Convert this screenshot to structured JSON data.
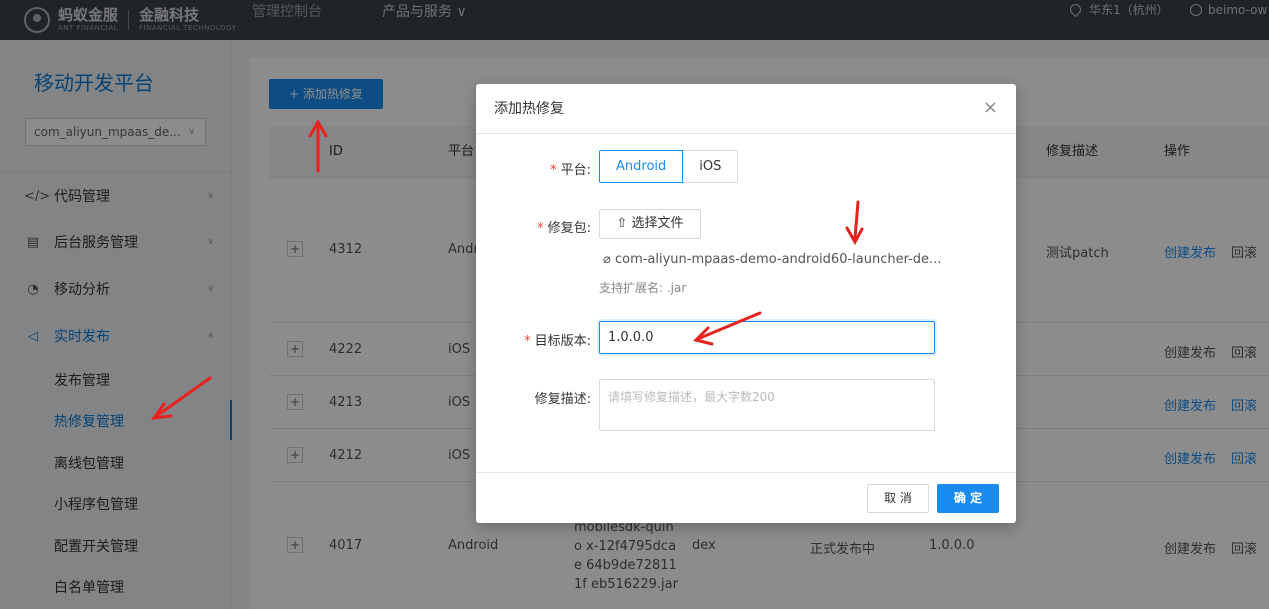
{
  "topbar": {
    "logo_cn_1": "蚂蚁金服",
    "logo_en_1": "ANT FINANCIAL",
    "logo_cn_2": "金融科技",
    "logo_en_2": "FINANCIAL TECHNOLOGY",
    "console": "管理控制台",
    "products": "产品与服务 ∨",
    "region": "华东1（杭州）",
    "user": "beimo-ow"
  },
  "sidebar": {
    "title": "移动开发平台",
    "app_select": "com_aliyun_mpaas_de...",
    "items": [
      {
        "icon": "</>",
        "label": "代码管理"
      },
      {
        "icon": "▤",
        "label": "后台服务管理"
      },
      {
        "icon": "◔",
        "label": "移动分析"
      },
      {
        "icon": "◁",
        "label": "实时发布"
      }
    ],
    "sub_items": [
      "发布管理",
      "热修复管理",
      "离线包管理",
      "小程序包管理",
      "配置开关管理",
      "白名单管理"
    ]
  },
  "main": {
    "add_button": "+ 添加热修复",
    "columns": {
      "id": "ID",
      "platform": "平台",
      "desc": "修复描述",
      "actions": "操作"
    },
    "rows": [
      {
        "id": "4312",
        "platform": "Andr",
        "desc": "测试patch",
        "publish": "创建发布",
        "rollback": "回滚"
      },
      {
        "id": "4222",
        "platform": "iOS",
        "desc": "",
        "publish": "创建发布",
        "rollback": "回滚"
      },
      {
        "id": "4213",
        "platform": "iOS",
        "desc": "",
        "publish": "创建发布",
        "rollback": "回滚"
      },
      {
        "id": "4212",
        "platform": "iOS",
        "desc": "",
        "publish": "创建发布",
        "rollback": "回滚"
      },
      {
        "id": "4017",
        "platform": "Android",
        "file": "mobilesdk-quino x-12f4795dcae 64b9de728111f eb516229.jar",
        "type": "dex",
        "status": "正式发布中",
        "version": "1.0.0.0",
        "publish": "创建发布",
        "rollback": "回滚"
      }
    ]
  },
  "dialog": {
    "title": "添加热修复",
    "close": "×",
    "platform_label": "平台:",
    "platform_options": [
      "Android",
      "iOS"
    ],
    "package_label": "修复包:",
    "choose_file": "选择文件",
    "file_name": "com-aliyun-mpaas-demo-android60-launcher-de...",
    "ext_hint": "支持扩展名: .jar",
    "version_label": "目标版本:",
    "version_value": "1.0.0.0",
    "desc_label": "修复描述:",
    "desc_placeholder": "请填写修复描述，最大字数200",
    "cancel": "取 消",
    "ok": "确 定"
  },
  "colors": {
    "accent": "#1a8cf0",
    "annotation": "#e8231f"
  }
}
